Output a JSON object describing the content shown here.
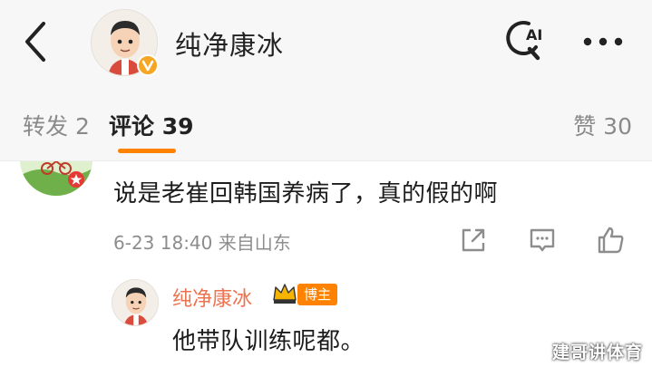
{
  "header": {
    "title": "纯净康冰",
    "back_icon": "chevron-left-icon",
    "search_icon": "ai-search-icon",
    "search_icon_text": "AI",
    "more_icon": "more-dots-icon",
    "verified_color": "#f5a623"
  },
  "tabs": {
    "repost_label": "转发 2",
    "comments_label": "评论 39",
    "likes_label": "赞 30",
    "accent": "#ff8200"
  },
  "comment": {
    "text": "说是老崔回韩国养病了，真的假的啊",
    "meta": "6-23 18:40  来自山东",
    "actions": [
      "share-icon",
      "reply-icon",
      "like-icon"
    ]
  },
  "reply": {
    "author": "纯净康冰",
    "badge": "博主",
    "text": "他带队训练呢都。",
    "name_color": "#eb7350"
  },
  "watermark": "建哥讲体育"
}
